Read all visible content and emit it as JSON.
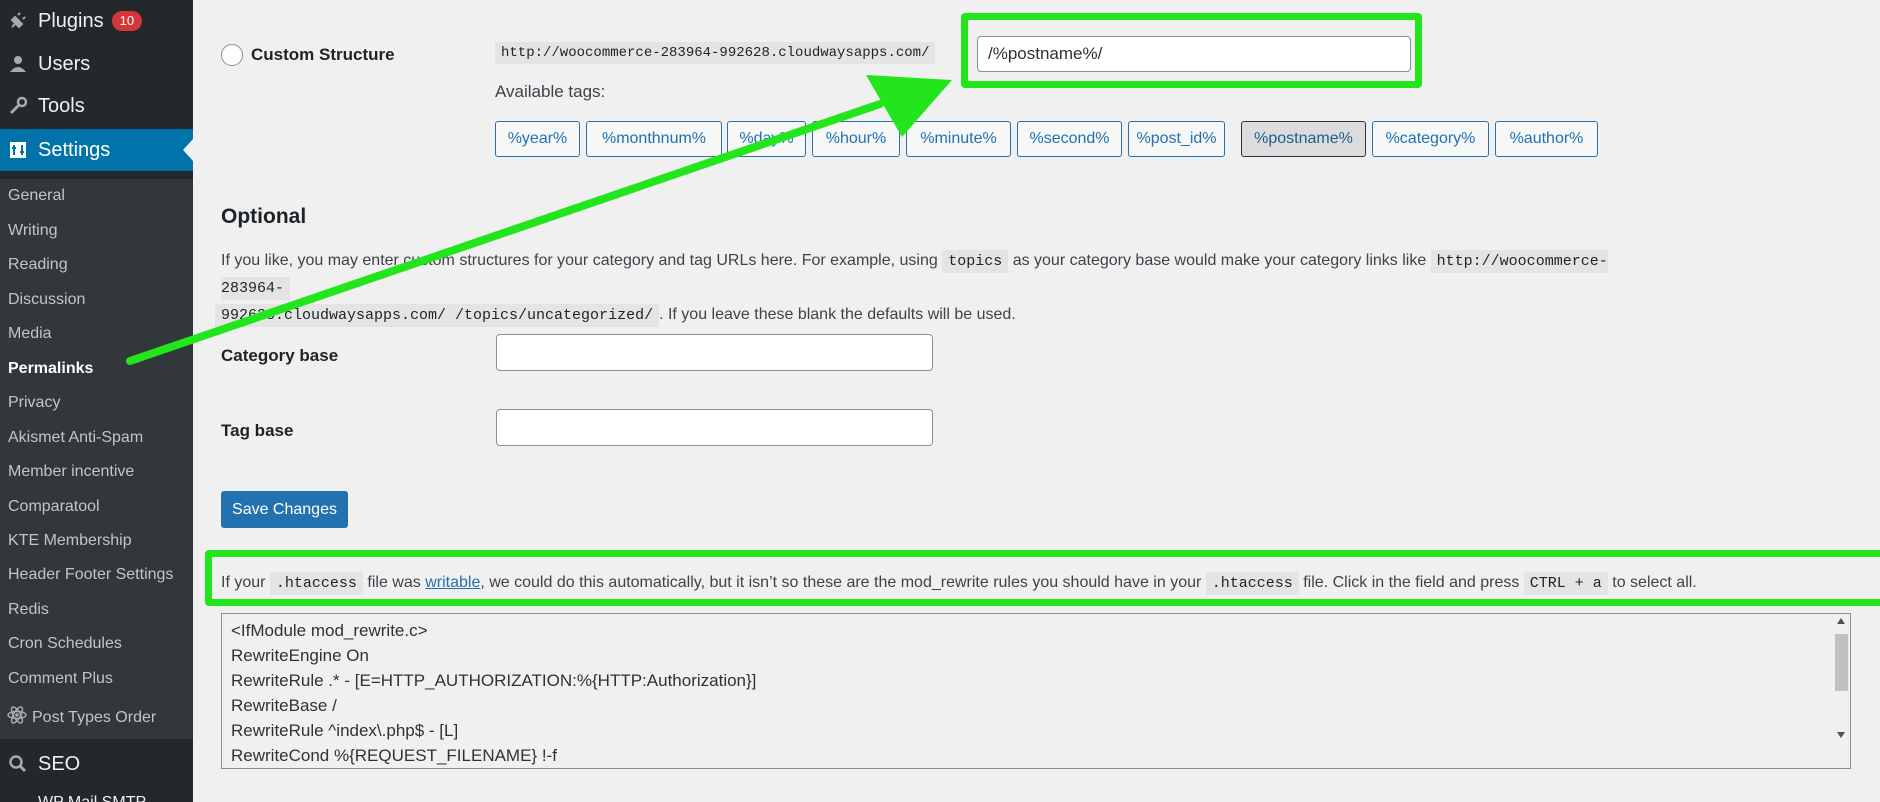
{
  "sidebar": {
    "top_items": [
      {
        "label": "Plugins",
        "badge": "10",
        "icon": "plugins-icon"
      },
      {
        "label": "Users",
        "icon": "users-icon"
      },
      {
        "label": "Tools",
        "icon": "tools-icon"
      },
      {
        "label": "Settings",
        "icon": "settings-icon"
      }
    ],
    "sub_items": [
      "General",
      "Writing",
      "Reading",
      "Discussion",
      "Media",
      "Permalinks",
      "Privacy",
      "Akismet Anti-Spam",
      "Member incentive",
      "Comparatool",
      "KTE Membership",
      "Header Footer Settings",
      "Redis",
      "Cron Schedules",
      "Comment Plus",
      "Post Types Order"
    ],
    "seo_label": "SEO",
    "partial_item": "WP Mail SMTP"
  },
  "custom_structure": {
    "label": "Custom Structure",
    "base_url": "http://woocommerce-283964-992628.cloudwaysapps.com/",
    "value": "/%postname%/",
    "available_tags_label": "Available tags:",
    "tags": [
      "%year%",
      "%monthnum%",
      "%day%",
      "%hour%",
      "%minute%",
      "%second%",
      "%post_id%",
      "%postname%",
      "%category%",
      "%author%"
    ],
    "active_tag": "%postname%"
  },
  "optional": {
    "heading": "Optional",
    "desc_part1": "If you like, you may enter custom structures for your category and tag URLs here. For example, using",
    "code_topics": "topics",
    "desc_part2": "as your category base would make your category links like",
    "code_url_line1": "http://woocommerce-283964-",
    "code_url_line2": "992628.cloudwaysapps.com/ /topics/uncategorized/",
    "desc_part3": ". If you leave these blank the defaults will be used.",
    "category_base_label": "Category base",
    "category_base_value": "",
    "tag_base_label": "Tag base",
    "tag_base_value": ""
  },
  "save_button": "Save Changes",
  "htaccess": {
    "part1": "If your",
    "code1": ".htaccess",
    "part2": "file was",
    "link": "writable",
    "part3": ", we could do this automatically, but it isn’t so these are the mod_rewrite rules you should have in your",
    "code2": ".htaccess",
    "part4": "file. Click in the field and press",
    "code3": "CTRL + a",
    "part5": "to select all."
  },
  "rules": [
    "<IfModule mod_rewrite.c>",
    "RewriteEngine On",
    "RewriteRule .* - [E=HTTP_AUTHORIZATION:%{HTTP:Authorization}]",
    "RewriteBase /",
    "RewriteRule ^index\\.php$ - [L]",
    "RewriteCond %{REQUEST_FILENAME} !-f"
  ],
  "colors": {
    "annotation": "#22e51c",
    "accent": "#2271b1",
    "sidebar": "#23282d"
  }
}
